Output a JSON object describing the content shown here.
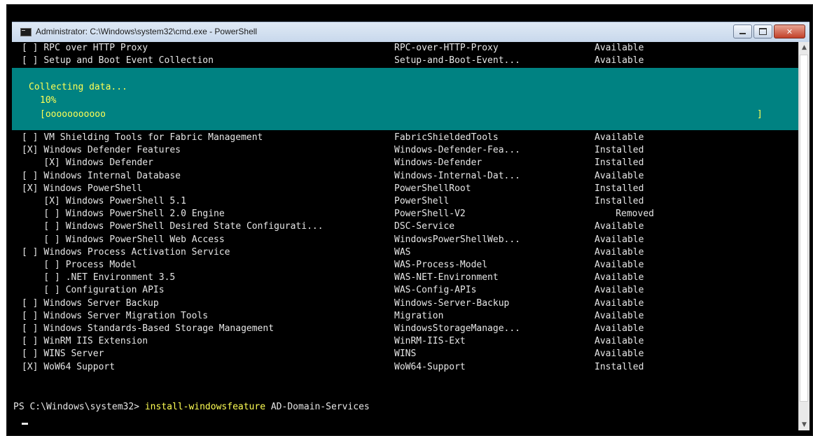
{
  "window": {
    "title": "Administrator: C:\\Windows\\system32\\cmd.exe - PowerShell",
    "buttons": {
      "minimize": "—",
      "maximize": "□",
      "close": "✕"
    }
  },
  "progress": {
    "activity": "Collecting data...",
    "percent_label": "10%",
    "percent": 10,
    "bar_start": "[",
    "bar_fill": "ooooooooooo",
    "bar_end": "]"
  },
  "top_rows": [
    {
      "check": "[ ]",
      "indent": 0,
      "name": "RPC over HTTP Proxy",
      "feature": "RPC-over-HTTP-Proxy",
      "state": "Available"
    },
    {
      "check": "[ ]",
      "indent": 0,
      "name": "Setup and Boot Event Collection",
      "feature": "Setup-and-Boot-Event...",
      "state": "Available"
    }
  ],
  "rows": [
    {
      "check": "[ ]",
      "indent": 0,
      "name": "VM Shielding Tools for Fabric Management",
      "feature": "FabricShieldedTools",
      "state": "Available"
    },
    {
      "check": "[X]",
      "indent": 0,
      "name": "Windows Defender Features",
      "feature": "Windows-Defender-Fea...",
      "state": "Installed"
    },
    {
      "check": "[X]",
      "indent": 1,
      "name": "Windows Defender",
      "feature": "Windows-Defender",
      "state": "Installed"
    },
    {
      "check": "[ ]",
      "indent": 0,
      "name": "Windows Internal Database",
      "feature": "Windows-Internal-Dat...",
      "state": "Available"
    },
    {
      "check": "[X]",
      "indent": 0,
      "name": "Windows PowerShell",
      "feature": "PowerShellRoot",
      "state": "Installed"
    },
    {
      "check": "[X]",
      "indent": 1,
      "name": "Windows PowerShell 5.1",
      "feature": "PowerShell",
      "state": "Installed"
    },
    {
      "check": "[ ]",
      "indent": 1,
      "name": "Windows PowerShell 2.0 Engine",
      "feature": "PowerShell-V2",
      "state": "Removed"
    },
    {
      "check": "[ ]",
      "indent": 1,
      "name": "Windows PowerShell Desired State Configurati...",
      "feature": "DSC-Service",
      "state": "Available"
    },
    {
      "check": "[ ]",
      "indent": 1,
      "name": "Windows PowerShell Web Access",
      "feature": "WindowsPowerShellWeb...",
      "state": "Available"
    },
    {
      "check": "[ ]",
      "indent": 0,
      "name": "Windows Process Activation Service",
      "feature": "WAS",
      "state": "Available"
    },
    {
      "check": "[ ]",
      "indent": 1,
      "name": "Process Model",
      "feature": "WAS-Process-Model",
      "state": "Available"
    },
    {
      "check": "[ ]",
      "indent": 1,
      "name": ".NET Environment 3.5",
      "feature": "WAS-NET-Environment",
      "state": "Available"
    },
    {
      "check": "[ ]",
      "indent": 1,
      "name": "Configuration APIs",
      "feature": "WAS-Config-APIs",
      "state": "Available"
    },
    {
      "check": "[ ]",
      "indent": 0,
      "name": "Windows Server Backup",
      "feature": "Windows-Server-Backup",
      "state": "Available"
    },
    {
      "check": "[ ]",
      "indent": 0,
      "name": "Windows Server Migration Tools",
      "feature": "Migration",
      "state": "Available"
    },
    {
      "check": "[ ]",
      "indent": 0,
      "name": "Windows Standards-Based Storage Management",
      "feature": "WindowsStorageManage...",
      "state": "Available"
    },
    {
      "check": "[ ]",
      "indent": 0,
      "name": "WinRM IIS Extension",
      "feature": "WinRM-IIS-Ext",
      "state": "Available"
    },
    {
      "check": "[ ]",
      "indent": 0,
      "name": "WINS Server",
      "feature": "WINS",
      "state": "Available"
    },
    {
      "check": "[X]",
      "indent": 0,
      "name": "WoW64 Support",
      "feature": "WoW64-Support",
      "state": "Installed"
    }
  ],
  "prompt": {
    "path": "PS C:\\Windows\\system32>",
    "command": "install-windowsfeature",
    "argument": "AD-Domain-Services"
  },
  "scrollbar": {
    "up": "▲",
    "down": "▼"
  },
  "colors": {
    "console_bg": "#000000",
    "console_fg": "#e6e6e6",
    "progress_bg": "#008282",
    "progress_fg": "#ffff54",
    "command_fg": "#ffff54"
  }
}
